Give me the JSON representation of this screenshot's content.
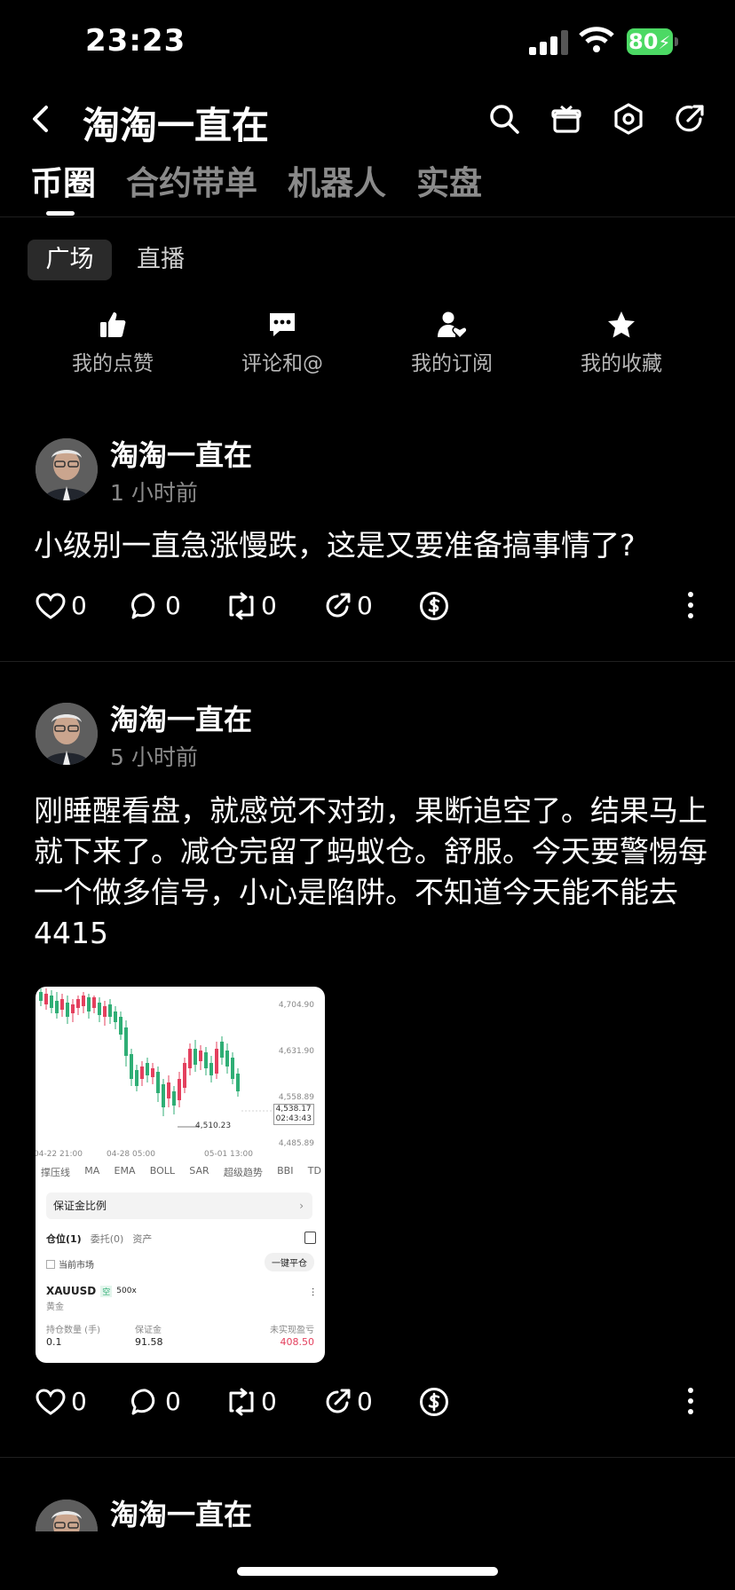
{
  "status": {
    "time": "23:23",
    "battery": "80"
  },
  "header": {
    "title": "淘淘一直在"
  },
  "tabs": [
    "币圈",
    "合约带单",
    "机器人",
    "实盘"
  ],
  "subtabs": {
    "active": "广场",
    "other": "直播"
  },
  "quick_actions": [
    "我的点赞",
    "评论和@",
    "我的订阅",
    "我的收藏"
  ],
  "posts": [
    {
      "user": "淘淘一直在",
      "time": "1 小时前",
      "text": "小级别一直急涨慢跌，这是又要准备搞事情了?",
      "likes": "0",
      "comments": "0",
      "reposts": "0",
      "shares": "0"
    },
    {
      "user": "淘淘一直在",
      "time": "5 小时前",
      "text": "刚睡醒看盘，就感觉不对劲，果断追空了。结果马上就下来了。减仓完留了蚂蚁仓。舒服。今天要警惕每一个做多信号，小心是陷阱。不知道今天能不能去4415",
      "likes": "0",
      "comments": "0",
      "reposts": "0",
      "shares": "0"
    },
    {
      "user": "淘淘一直在"
    }
  ],
  "embed": {
    "y_labels": [
      "4,704.90",
      "4,631.90",
      "4,558.89",
      "4,485.89"
    ],
    "price_tag": "4,538.17",
    "countdown": "02:43:43",
    "low_label": "4,510.23",
    "x_labels": [
      "04-22 21:00",
      "04-28 05:00",
      "05-01 13:00"
    ],
    "indicators": [
      "撑压线",
      "MA",
      "EMA",
      "BOLL",
      "SAR",
      "超级趋势",
      "BBI",
      "TD"
    ],
    "margin_ratio": "保证金比例",
    "pos_tabs": [
      "仓位(1)",
      "委托(0)",
      "资产"
    ],
    "current_market": "当前市场",
    "close_all": "一键平仓",
    "symbol": "XAUUSD",
    "side": "空",
    "leverage": "500x",
    "symbol_cn": "黄金",
    "col_qty": "持仓数量 (手)",
    "col_margin": "保证金",
    "col_pnl": "未实现盈亏",
    "qty": "0.1",
    "margin": "91.58",
    "pnl": "408.50"
  }
}
